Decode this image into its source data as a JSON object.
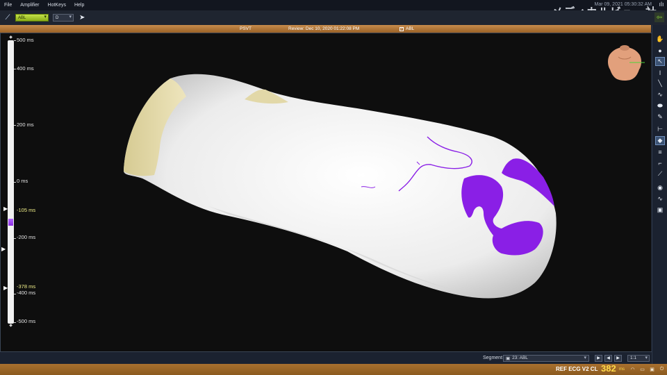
{
  "menu": {
    "items": [
      "File",
      "Amplifier",
      "HotKeys",
      "Help"
    ]
  },
  "header": {
    "datetime": "Mar 09, 2021 05:30:32 AM",
    "watermark": "メディカルビュー社"
  },
  "toolbar": {
    "channel_select": "ABL",
    "mode_select": "D"
  },
  "titlebar": {
    "map_name": "PSVT",
    "review": "Review: Dec 10, 2020 01:22:08 PM",
    "catheter": "ABL"
  },
  "time_scale": {
    "labels": [
      "500 ms",
      "400 ms",
      "200 ms",
      "0 ms",
      "-105 ms",
      "-200 ms",
      "-378 ms",
      "-400 ms",
      "-500 ms"
    ],
    "window_upper": "-105 ms",
    "window_lower": "-378 ms"
  },
  "segment": {
    "label": "Segment",
    "value": "23: ABL",
    "zoom": "1:1"
  },
  "ref_ecg": {
    "label": "REF ECG V2 CL",
    "value": "382",
    "unit": "ms"
  },
  "colors": {
    "activation": "#8a1fe6",
    "anatomy": "#f2f2f2",
    "valve_region": "#e4d9a6",
    "status_bar": "#a8702f",
    "selector": "#a8cc2a"
  },
  "icons": {
    "right_tools": [
      "hand-icon",
      "dot-icon",
      "pointer-icon",
      "caliper-icon",
      "catheter-icon",
      "curve-icon",
      "ellipse-icon",
      "pen-icon",
      "measure-icon",
      "tag-icon",
      "split-icon",
      "bend-icon",
      "needle-icon",
      "eye-icon",
      "waveform-icon",
      "camera-icon"
    ]
  }
}
